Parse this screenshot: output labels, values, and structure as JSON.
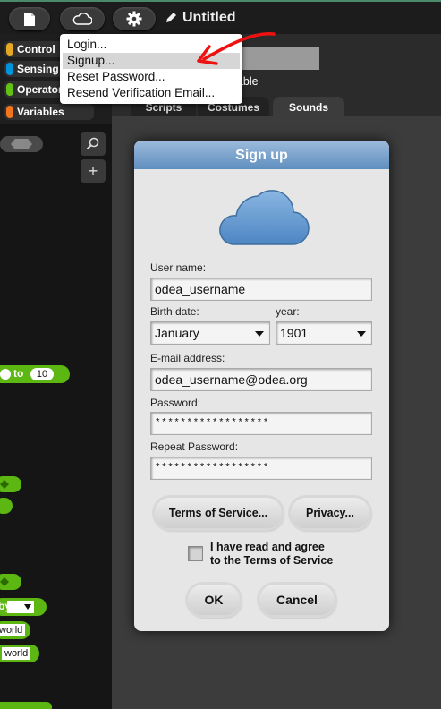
{
  "topbar": {
    "title": "Untitled",
    "icons": {
      "file": "file-icon",
      "cloud": "cloud-icon",
      "settings": "gear-icon",
      "edit": "pencil-icon"
    }
  },
  "categories": [
    {
      "label": "Control",
      "color": "#e6a822"
    },
    {
      "label": "Sensing",
      "color": "#0094dd"
    },
    {
      "label": "Operators",
      "color": "#62c213"
    },
    {
      "label": "Variables",
      "color": "#f3761d"
    }
  ],
  "palette": {
    "to_label": "to",
    "to_value": "10",
    "by_label": "by",
    "world_1": "world",
    "world_2": "world"
  },
  "stage": {
    "partial_label": "gable"
  },
  "tabs": [
    "Scripts",
    "Costumes",
    "Sounds"
  ],
  "cloud_menu": {
    "items": [
      "Login...",
      "Signup...",
      "Reset Password...",
      "Resend Verification Email..."
    ],
    "highlighted_index": 1
  },
  "dialog": {
    "title": "Sign up",
    "username_label": "User name:",
    "username_value": "odea_username",
    "birthdate_label": "Birth date:",
    "month_value": "January",
    "year_label": "year:",
    "year_value": "1901",
    "email_label": "E-mail address:",
    "email_value": "odea_username@odea.org",
    "password_label": "Password:",
    "password_value": "******************",
    "repeat_password_label": "Repeat Password:",
    "repeat_password_value": "******************",
    "terms_button": "Terms of Service...",
    "privacy_button": "Privacy...",
    "agree_line1": "I have read and agree",
    "agree_line2": "to the Terms of Service",
    "agree_checked": false,
    "ok_button": "OK",
    "cancel_button": "Cancel"
  },
  "colors": {
    "annotation_arrow": "#ee1111",
    "dialog_title_bg": "#6f9ccb",
    "cloud_icon": "#5b93cf"
  }
}
